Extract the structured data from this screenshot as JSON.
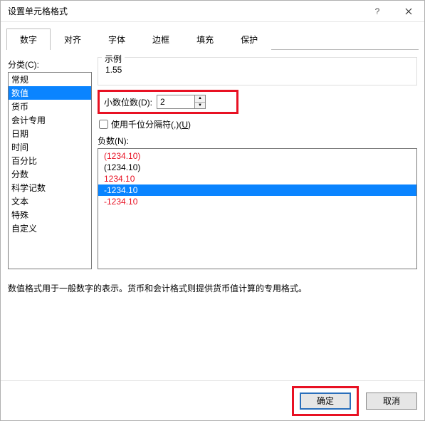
{
  "window": {
    "title": "设置单元格格式",
    "help_icon": "help-icon",
    "close_icon": "close-icon"
  },
  "tabs": {
    "items": [
      {
        "label": "数字",
        "active": true
      },
      {
        "label": "对齐",
        "active": false
      },
      {
        "label": "字体",
        "active": false
      },
      {
        "label": "边框",
        "active": false
      },
      {
        "label": "填充",
        "active": false
      },
      {
        "label": "保护",
        "active": false
      }
    ]
  },
  "category": {
    "label": "分类(C):",
    "items": [
      "常规",
      "数值",
      "货币",
      "会计专用",
      "日期",
      "时间",
      "百分比",
      "分数",
      "科学记数",
      "文本",
      "特殊",
      "自定义"
    ],
    "selected_index": 1
  },
  "sample": {
    "label": "示例",
    "value": "1.55"
  },
  "decimal": {
    "label": "小数位数(D):",
    "value": "2"
  },
  "thousands": {
    "label_prefix": "使用千位分隔符(,)(",
    "label_mnemonic": "U",
    "label_suffix": ")",
    "checked": false
  },
  "negative": {
    "label": "负数(N):",
    "items": [
      {
        "text": "(1234.10)",
        "color": "red"
      },
      {
        "text": "(1234.10)",
        "color": "black"
      },
      {
        "text": "1234.10",
        "color": "red"
      },
      {
        "text": "-1234.10",
        "color": "black",
        "selected": true
      },
      {
        "text": "-1234.10",
        "color": "red"
      }
    ]
  },
  "description": "数值格式用于一般数字的表示。货币和会计格式则提供货币值计算的专用格式。",
  "footer": {
    "ok": "确定",
    "cancel": "取消"
  }
}
